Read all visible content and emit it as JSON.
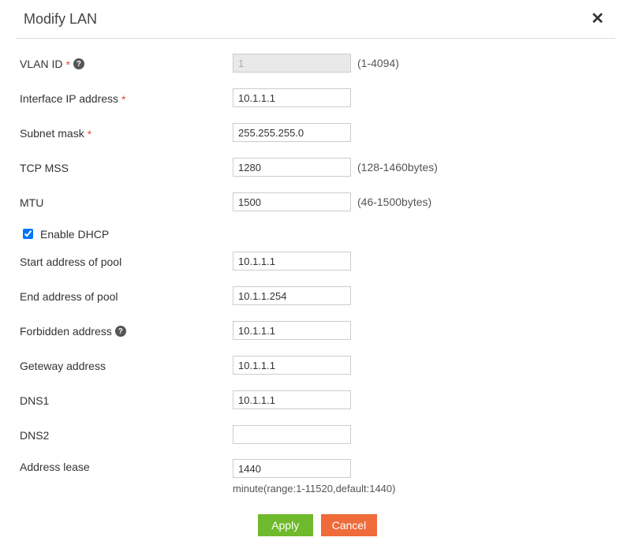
{
  "header": {
    "title": "Modify LAN",
    "close": "✕"
  },
  "labels": {
    "vlan_id": "VLAN ID",
    "interface_ip": "Interface IP address",
    "subnet_mask": "Subnet mask",
    "tcp_mss": "TCP MSS",
    "mtu": "MTU",
    "enable_dhcp": "Enable DHCP",
    "start_pool": "Start address of pool",
    "end_pool": "End address of pool",
    "forbidden": "Forbidden address",
    "gateway": "Geteway address",
    "dns1": "DNS1",
    "dns2": "DNS2",
    "lease": "Address lease"
  },
  "required_marker": "*",
  "help_icon": "?",
  "values": {
    "vlan_id": "1",
    "interface_ip": "10.1.1.1",
    "subnet_mask": "255.255.255.0",
    "tcp_mss": "1280",
    "mtu": "1500",
    "enable_dhcp": true,
    "start_pool": "10.1.1.1",
    "end_pool": "10.1.1.254",
    "forbidden": "10.1.1.1",
    "gateway": "10.1.1.1",
    "dns1": "10.1.1.1",
    "dns2": "",
    "lease": "1440"
  },
  "hints": {
    "vlan_id": "(1-4094)",
    "tcp_mss": "(128-1460bytes)",
    "mtu": "(46-1500bytes)",
    "lease": "minute(range:1-11520,default:1440)"
  },
  "buttons": {
    "apply": "Apply",
    "cancel": "Cancel"
  }
}
